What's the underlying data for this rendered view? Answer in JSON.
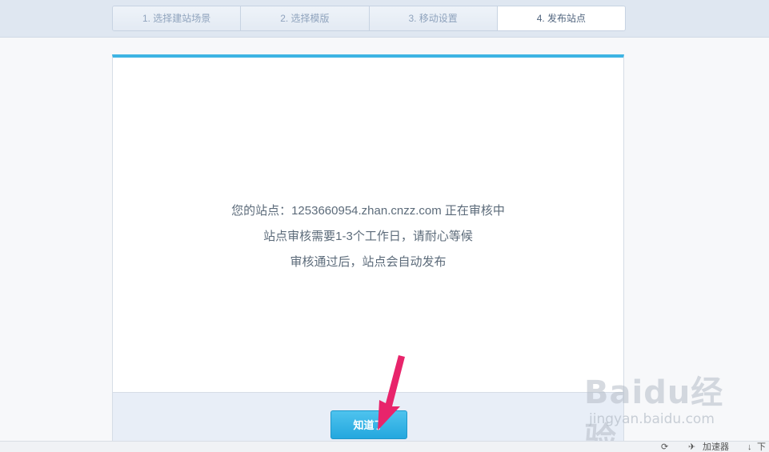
{
  "steps": [
    {
      "label": "1. 选择建站场景",
      "active": false
    },
    {
      "label": "2. 选择模版",
      "active": false
    },
    {
      "label": "3. 移动设置",
      "active": false
    },
    {
      "label": "4. 发布站点",
      "active": true
    }
  ],
  "message": {
    "line1": "您的站点：1253660954.zhan.cnzz.com 正在审核中",
    "line2": "站点审核需要1-3个工作日，请耐心等候",
    "line3": "审核通过后，站点会自动发布"
  },
  "footer": {
    "ok_label": "知道了"
  },
  "watermark": {
    "logo": "Baidu经验",
    "url": "jingyan.baidu.com"
  },
  "statusbar": {
    "accelerator": "加速器",
    "download": "下"
  },
  "colors": {
    "accent": "#3db4e3",
    "button": "#23a7de",
    "arrow": "#e8246b"
  }
}
